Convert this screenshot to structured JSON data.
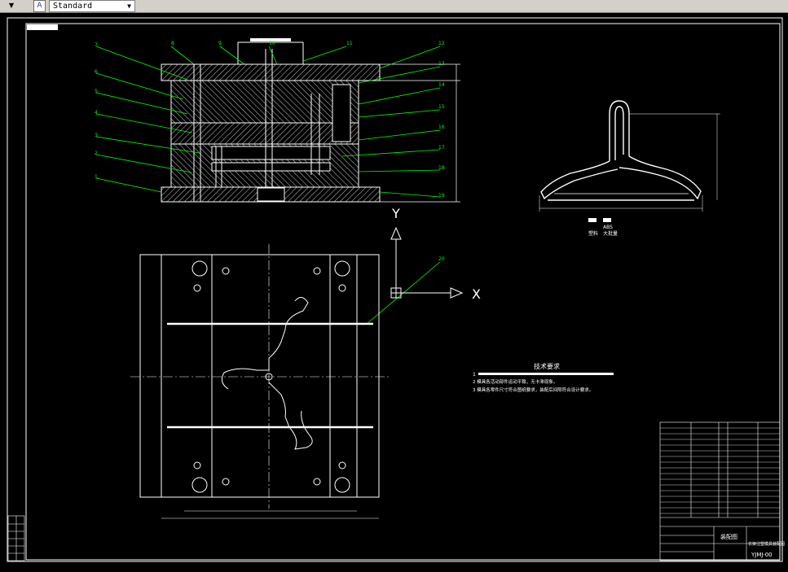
{
  "toolbar": {
    "textstyle_value": "Standard",
    "dropdown_arrow": "chevron-down-icon",
    "style_icon": "text-style-icon"
  },
  "drawing": {
    "ucs_y": "Y",
    "ucs_x": "X",
    "tech_title": "技术要求",
    "tech_items": [
      "1",
      "2  模具各活动部件运动平稳，无卡滞现象。",
      "3  模具各零件尺寸符合图纸要求，装配后间隙符合设计要求。"
    ],
    "legend": [
      "ABS",
      "塑料",
      "大批量"
    ],
    "title_block": {
      "name": "装配图",
      "part": "衣架注塑模具装配图",
      "code": "YJMJ-00"
    },
    "callouts": [
      "1",
      "2",
      "3",
      "4",
      "5",
      "6",
      "7",
      "8",
      "9",
      "10",
      "11",
      "12",
      "13",
      "14",
      "15",
      "16",
      "17",
      "18",
      "19",
      "20"
    ]
  },
  "colors": {
    "background": "#000000",
    "lines": "#ffffff",
    "leaders": "#00ff00",
    "toolbar": "#d4d0c8"
  }
}
